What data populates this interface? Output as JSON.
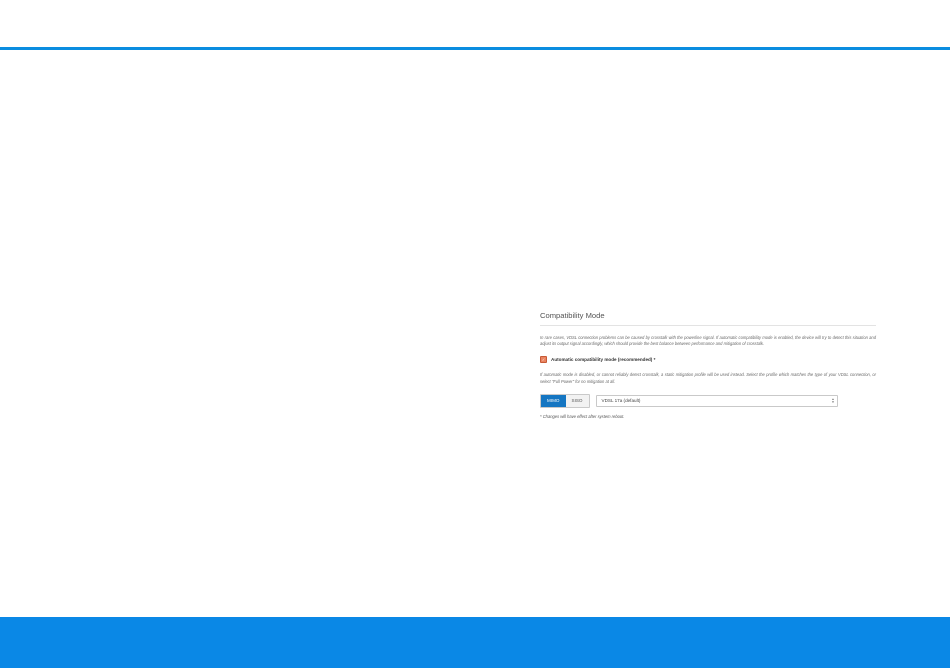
{
  "compatibility": {
    "title": "Compatibility Mode",
    "intro": "In rare cases, VDSL connection problems can be caused by crosstalk with the powerline signal. If automatic compatibility mode is enabled, the device will try to detect this situation and adjust its output signal accordingly, which should provide the best balance between performance and mitigation of crosstalk.",
    "auto_checkbox_label": "Automatic compatibility mode (recommended) *",
    "auto_checkbox_checked": true,
    "manual_desc": "If automatic mode is disabled, or cannot reliably detect crosstalk, a static mitigation profile will be used instead. Select the profile which matches the type of your VDSL connection, or select \"Full Power\" for no mitigation at all.",
    "mode_options": [
      "MIMO",
      "SISO"
    ],
    "mode_selected": "MIMO",
    "profile_value": "VDSL 17a (default)",
    "reboot_note": "* Changes will have effect after system reboot."
  },
  "colors": {
    "accent": "#0a8de0",
    "footer": "#0a88e6",
    "mimo_active": "#1576c2",
    "checkbox": "#e9825f"
  }
}
